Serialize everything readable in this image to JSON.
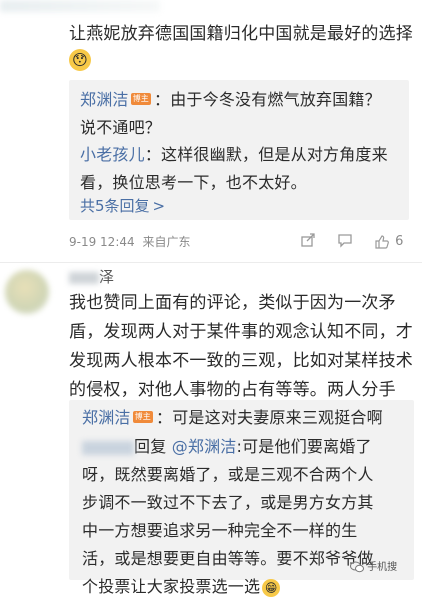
{
  "top_blur_text": "",
  "comment1": {
    "text": "让燕妮放弃德国国籍归化中国就是最好的选择",
    "emoji": "😯",
    "replies": [
      {
        "author": "郑渊洁",
        "badge": "博主",
        "sep": "：",
        "text_line1": "由于今冬没有燃气放弃国籍？",
        "text_line2": "说不通吧？"
      },
      {
        "author": "小老孩儿",
        "sep": "：",
        "text_line1": "这样很幽默，但是从对方角度来",
        "text_line2": "看，换位思考一下，也不太好。"
      }
    ],
    "more_replies": "共5条回复",
    "more_arrow": ">",
    "meta_time": "9-19 12:44",
    "meta_source": "来自广东",
    "like_count": "6"
  },
  "comment2": {
    "username_tail": "泽",
    "lines": [
      "我也赞同上面有的评论，类似于因为一次矛",
      "盾，发现两人对于某件事的观念认知不同，才",
      "发现两人根本不一致的三观，比如对某样技术",
      "的侵权，对他人事物的占有等等。两人分手"
    ],
    "reply1": {
      "author": "郑渊洁",
      "badge": "博主",
      "sep": "：",
      "text": "可是这对夫妻原来三观挺合啊"
    },
    "reply2": {
      "prefix": "回复",
      "mention": "@郑渊洁",
      "sep": ":",
      "line1": "可是他们要离婚了",
      "lines": [
        "呀，既然要离婚了，或是三观不合两个人",
        "步调不一致过不下去了，或是男方女方其",
        "中一方想要追求另一种完全不一样的生",
        "活，或是想要更自由等等。要不郑爷爷做",
        "个投票让大家投票选一选"
      ],
      "emoji": "😁"
    }
  },
  "watermark": "手机搜"
}
